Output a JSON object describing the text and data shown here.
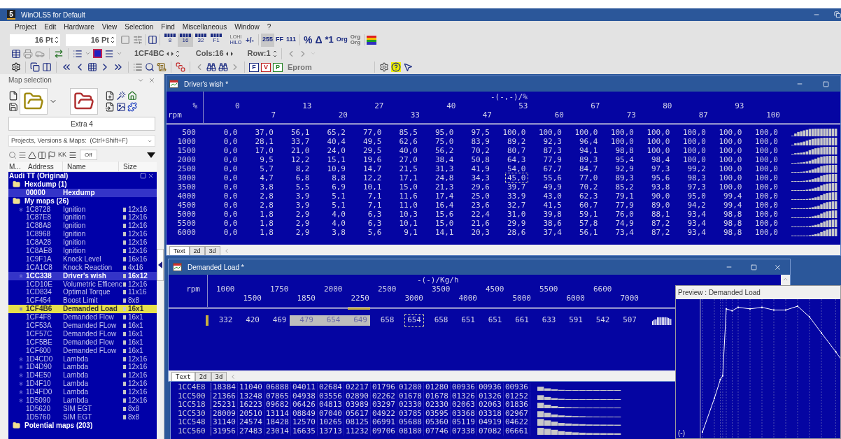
{
  "app": {
    "logo_text": "5",
    "title": "WinOLS5 for Default"
  },
  "menu": [
    "Project",
    "Edit",
    "Hardware",
    "View",
    "Selection",
    "Find",
    "Miscellaneous",
    "Window",
    "?"
  ],
  "toolbar": {
    "font_size_1": "16 Pt",
    "font_size_2": "16 Pt",
    "width_buttons": [
      {
        "label": "8",
        "selected": false
      },
      {
        "label": "16",
        "selected": true
      },
      {
        "label": "32",
        "selected": false
      },
      {
        "label": "F1",
        "selected": false
      }
    ],
    "lohi": [
      "LOHI",
      "HILO"
    ],
    "sign": "+/-",
    "format_buttons": [
      {
        "label": "255",
        "selected": true
      },
      {
        "label": "FF",
        "selected": false
      },
      {
        "label": "111",
        "selected": false
      }
    ],
    "percent": "%",
    "delta": "Δ",
    "factor": "*1",
    "org": "Org",
    "org_org": [
      "Org",
      "Org"
    ],
    "address": "1CF4BC",
    "cols": "Cols:16",
    "row": "Row:1",
    "fvp": [
      {
        "label": "F",
        "color": "#1a2a80"
      },
      {
        "label": "V",
        "color": "#c02020"
      },
      {
        "label": "P",
        "color": "#208020"
      }
    ],
    "eprom": "Eprom"
  },
  "panel": {
    "title": "Map selection",
    "extra_button": "Extra 4",
    "search": "Projects, Versions & Maps:  (Ctrl+Shift+F)",
    "kk": "KK",
    "off": "Off",
    "columns": [
      "M...",
      "Address",
      "Name",
      "Size"
    ]
  },
  "tree": {
    "title": "Audi TT (Original)",
    "children": [
      {
        "label": "Hexdump (1)",
        "children": [
          {
            "address": "00000",
            "name": "Hexdump",
            "starred": false,
            "open": true,
            "selected": false
          }
        ]
      },
      {
        "label": "My maps (26)",
        "children": [
          {
            "address": "1C8728",
            "name": "Ignition",
            "size": "12x16",
            "starred": true,
            "open": false,
            "selected": false
          },
          {
            "address": "1C87E8",
            "name": "Ignition",
            "size": "12x16",
            "starred": false,
            "open": false,
            "selected": false
          },
          {
            "address": "1C88A8",
            "name": "Ignition",
            "size": "12x16",
            "starred": false,
            "open": false,
            "selected": false
          },
          {
            "address": "1C8968",
            "name": "Ignition",
            "size": "12x16",
            "starred": false,
            "open": false,
            "selected": false
          },
          {
            "address": "1C8A28",
            "name": "Ignition",
            "size": "12x16",
            "starred": false,
            "open": false,
            "selected": false
          },
          {
            "address": "1C8AE8",
            "name": "Ignition",
            "size": "12x16",
            "starred": false,
            "open": false,
            "selected": false
          },
          {
            "address": "1C9F1A",
            "name": "Knock Level",
            "size": "16x16",
            "starred": false,
            "open": false,
            "selected": false
          },
          {
            "address": "1CA1C8",
            "name": "Knock Reaction",
            "size": "4x16",
            "starred": false,
            "open": false,
            "selected": false
          },
          {
            "address": "1CC338",
            "name": "Driver's wish",
            "size": "16x12",
            "starred": true,
            "open": true,
            "selected": false
          },
          {
            "address": "1CD10E",
            "name": "Volumetric Efficenc",
            "size": "12x16",
            "starred": false,
            "open": false,
            "selected": false
          },
          {
            "address": "1CD834",
            "name": "Optimal Torque",
            "size": "11x16",
            "starred": false,
            "open": false,
            "selected": false
          },
          {
            "address": "1CF454",
            "name": "Boost Limit",
            "size": "8x8",
            "starred": false,
            "open": false,
            "selected": false
          },
          {
            "address": "1CF4B6",
            "name": "Demanded Load",
            "size": "16x1",
            "starred": true,
            "open": false,
            "selected": true
          },
          {
            "address": "1CF4F8",
            "name": "Demanded Flow",
            "size": "16x1",
            "starred": false,
            "open": false,
            "selected": false
          },
          {
            "address": "1CF53A",
            "name": "Demanded FLow",
            "size": "16x1",
            "starred": false,
            "open": false,
            "selected": false
          },
          {
            "address": "1CF57C",
            "name": "Demanded FLow",
            "size": "16x1",
            "starred": false,
            "open": false,
            "selected": false
          },
          {
            "address": "1CF5BE",
            "name": "Demanded Flow",
            "size": "16x1",
            "starred": false,
            "open": false,
            "selected": false
          },
          {
            "address": "1CF600",
            "name": "Demanded FLow",
            "size": "16x1",
            "starred": false,
            "open": false,
            "selected": false
          },
          {
            "address": "1D4CD0",
            "name": "Lambda",
            "size": "12x16",
            "starred": true,
            "open": false,
            "selected": false
          },
          {
            "address": "1D4D90",
            "name": "Lambda",
            "size": "12x16",
            "starred": true,
            "open": false,
            "selected": false
          },
          {
            "address": "1D4E50",
            "name": "Lambda",
            "size": "12x16",
            "starred": true,
            "open": false,
            "selected": false
          },
          {
            "address": "1D4F10",
            "name": "Lambda",
            "size": "12x16",
            "starred": true,
            "open": false,
            "selected": false
          },
          {
            "address": "1D4FD0",
            "name": "Lambda",
            "size": "12x16",
            "starred": true,
            "open": false,
            "selected": false
          },
          {
            "address": "1D5090",
            "name": "Lambda",
            "size": "12x16",
            "starred": true,
            "open": false,
            "selected": false
          },
          {
            "address": "1D5620",
            "name": "SIM EGT",
            "size": "8x8",
            "starred": false,
            "open": false,
            "selected": false
          },
          {
            "address": "1D5760",
            "name": "SIM EGT",
            "size": "8x8",
            "starred": false,
            "open": false,
            "selected": false
          }
        ]
      },
      {
        "label": "Potential maps (203)"
      }
    ]
  },
  "drivers_wish": {
    "title": "Driver's wish *",
    "unit": "-(-,-)/%",
    "x_label": "%",
    "y_label": "rpm",
    "x_axis": [
      "0",
      "7",
      "13",
      "20",
      "27",
      "33",
      "40",
      "47",
      "53",
      "60",
      "67",
      "73",
      "80",
      "87",
      "93",
      "100"
    ],
    "rows": [
      {
        "label": "500",
        "values": [
          "0,0",
          "37,0",
          "56,1",
          "65,2",
          "77,0",
          "85,5",
          "95,0",
          "97,5",
          "100,0",
          "100,0",
          "100,0",
          "100,0",
          "100,0",
          "100,0",
          "100,0",
          "100,0"
        ]
      },
      {
        "label": "1000",
        "values": [
          "0,0",
          "28,1",
          "33,7",
          "40,4",
          "49,5",
          "62,6",
          "75,0",
          "83,9",
          "89,2",
          "92,3",
          "96,4",
          "100,0",
          "100,0",
          "100,0",
          "100,0",
          "100,0"
        ]
      },
      {
        "label": "1500",
        "values": [
          "0,0",
          "17,0",
          "21,0",
          "24,0",
          "29,5",
          "40,0",
          "56,2",
          "70,2",
          "80,7",
          "87,3",
          "94,1",
          "98,8",
          "100,0",
          "100,0",
          "100,0",
          "100,0"
        ]
      },
      {
        "label": "2000",
        "values": [
          "0,0",
          "9,5",
          "12,2",
          "15,1",
          "19,6",
          "27,0",
          "38,4",
          "50,8",
          "64,3",
          "77,9",
          "89,3",
          "95,4",
          "98,4",
          "100,0",
          "100,0",
          "100,0"
        ]
      },
      {
        "label": "2500",
        "values": [
          "0,0",
          "5,7",
          "8,2",
          "10,9",
          "14,7",
          "21,5",
          "31,3",
          "41,9",
          "54,0",
          "67,7",
          "84,7",
          "92,9",
          "97,3",
          "99,2",
          "100,0",
          "100,0"
        ]
      },
      {
        "label": "3000",
        "values": [
          "0,0",
          "4,7",
          "6,8",
          "8,8",
          "12,2",
          "17,1",
          "24,8",
          "34,3",
          {
            "text": "45,0",
            "cursor": true
          },
          "55,6",
          "77,0",
          "89,3",
          "95,6",
          "98,3",
          "100,0",
          "100,0"
        ]
      },
      {
        "label": "3500",
        "values": [
          "0,0",
          "3,8",
          "5,5",
          "6,9",
          "10,1",
          "15,0",
          "21,3",
          "29,6",
          "39,7",
          "49,9",
          "70,2",
          "85,2",
          "93,8",
          "97,3",
          "100,0",
          "100,0"
        ]
      },
      {
        "label": "4000",
        "values": [
          "0,0",
          "2,8",
          "3,9",
          "5,1",
          "7,1",
          "11,6",
          "17,4",
          "25,0",
          "33,9",
          "43,0",
          "62,3",
          "79,1",
          "90,0",
          "95,0",
          "99,4",
          "100,0"
        ]
      },
      {
        "label": "4500",
        "values": [
          "0,0",
          "2,8",
          "3,9",
          "5,1",
          "7,1",
          "11,0",
          "16,4",
          "23,6",
          "32,7",
          "41,5",
          "60,7",
          "77,9",
          "89,0",
          "94,2",
          "99,4",
          "100,0"
        ]
      },
      {
        "label": "5000",
        "values": [
          "0,0",
          "1,8",
          "2,9",
          "4,0",
          "6,3",
          "10,3",
          "15,6",
          "22,4",
          "31,0",
          "39,8",
          "59,1",
          "76,0",
          "88,1",
          "93,4",
          "98,8",
          "100,0"
        ]
      },
      {
        "label": "5500",
        "values": [
          "0,0",
          "1,8",
          "2,9",
          "4,0",
          "6,3",
          "10,1",
          "15,0",
          "21,6",
          "29,9",
          "38,6",
          "57,8",
          "74,9",
          "87,2",
          "93,4",
          "98,8",
          "100,0"
        ]
      },
      {
        "label": "6000",
        "values": [
          "0,0",
          "1,8",
          "2,9",
          "3,8",
          "5,6",
          "9,1",
          "14,1",
          "20,3",
          "28,6",
          "37,4",
          "56,1",
          "73,4",
          "87,2",
          "93,4",
          "98,8",
          "100,0"
        ]
      }
    ],
    "tabs": [
      {
        "label": "Text",
        "selected": true
      },
      {
        "label": "2d",
        "selected": false
      },
      {
        "label": "3d",
        "selected": false
      }
    ]
  },
  "demanded_load": {
    "title": "Demanded Load *",
    "unit": "-(-)/Kg/h",
    "y_label": "rpm",
    "row_marker": true,
    "x_axis": [
      {
        "label": "1000",
        "marked": false
      },
      {
        "label": "1500",
        "marked": false
      },
      {
        "label": "1750",
        "marked": false
      },
      {
        "label": "1850",
        "marked": false
      },
      {
        "label": "2000",
        "marked": false
      },
      {
        "label": "2250",
        "marked": true
      },
      {
        "label": "2500",
        "marked": false
      },
      {
        "label": "3000",
        "marked": false
      },
      {
        "label": "3500",
        "marked": false
      },
      {
        "label": "4000",
        "marked": false
      },
      {
        "label": "4500",
        "marked": false
      },
      {
        "label": "5000",
        "marked": false
      },
      {
        "label": "5500",
        "marked": false
      },
      {
        "label": "6000",
        "marked": false
      },
      {
        "label": "6600",
        "marked": false
      },
      {
        "label": "7000",
        "marked": false
      }
    ],
    "cells": [
      {
        "text": "332",
        "selected": false,
        "cursor": false
      },
      {
        "text": "420",
        "selected": false,
        "cursor": false
      },
      {
        "text": "469",
        "selected": false,
        "cursor": false
      },
      {
        "text": "479",
        "selected": true,
        "cursor": false
      },
      {
        "text": "654",
        "selected": true,
        "cursor": false
      },
      {
        "text": "649",
        "selected": true,
        "cursor": false
      },
      {
        "text": "658",
        "selected": false,
        "cursor": false
      },
      {
        "text": "654",
        "selected": false,
        "cursor": true
      },
      {
        "text": "658",
        "selected": false,
        "cursor": false
      },
      {
        "text": "651",
        "selected": false,
        "cursor": false
      },
      {
        "text": "651",
        "selected": false,
        "cursor": false
      },
      {
        "text": "661",
        "selected": false,
        "cursor": false
      },
      {
        "text": "633",
        "selected": false,
        "cursor": false
      },
      {
        "text": "591",
        "selected": false,
        "cursor": false
      },
      {
        "text": "542",
        "selected": false,
        "cursor": false
      },
      {
        "text": "507",
        "selected": false,
        "cursor": false
      }
    ],
    "tabs": [
      {
        "label": "Text",
        "selected": true
      },
      {
        "label": "2d",
        "selected": false
      },
      {
        "label": "3d",
        "selected": false
      }
    ]
  },
  "hexdump_rows": [
    {
      "address": "1CC4E8",
      "values": [
        "18384",
        "11040",
        "06888",
        "04011",
        "02684",
        "02217",
        "01796",
        "01280",
        "01280",
        "00936",
        "00936",
        "00936"
      ]
    },
    {
      "address": "1CC500",
      "values": [
        "21366",
        "13248",
        "07865",
        "04938",
        "03556",
        "02890",
        "02262",
        "01678",
        "01678",
        "01326",
        "01326",
        "01252"
      ]
    },
    {
      "address": "1CC518",
      "values": [
        "25231",
        "16223",
        "09682",
        "06426",
        "04813",
        "03989",
        "03297",
        "02330",
        "02330",
        "02063",
        "02063",
        "01836"
      ]
    },
    {
      "address": "1CC530",
      "values": [
        "28009",
        "20510",
        "13114",
        "08849",
        "07040",
        "05617",
        "04922",
        "03785",
        "03595",
        "03368",
        "03318",
        "02967"
      ]
    },
    {
      "address": "1CC548",
      "values": [
        "31140",
        "24574",
        "18428",
        "12570",
        "10265",
        "08125",
        "06991",
        "05688",
        "05360",
        "05119",
        "04919",
        "04622"
      ]
    },
    {
      "address": "1CC560",
      "values": [
        "31956",
        "27483",
        "23014",
        "16635",
        "13713",
        "11232",
        "09706",
        "08180",
        "07746",
        "07338",
        "07082",
        "06661"
      ]
    }
  ],
  "preview": {
    "title": "Preview : Demanded Load",
    "axis_label": "(-)"
  }
}
